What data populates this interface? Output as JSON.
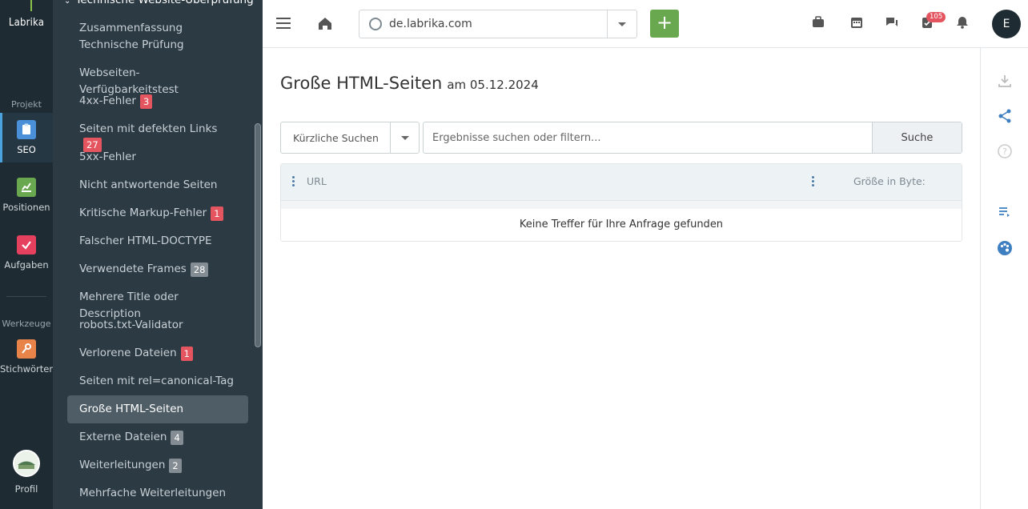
{
  "app": {
    "logo": "Labrika"
  },
  "rail": {
    "section_project": "Projekt",
    "section_tools": "Werkzeuge",
    "items": [
      {
        "label": "SEO",
        "icon": "clipboard-icon",
        "color": "#4a90d9",
        "active": true
      },
      {
        "label": "Positionen",
        "icon": "chart-icon",
        "color": "#6aa84f"
      },
      {
        "label": "Aufgaben",
        "icon": "check-icon",
        "color": "#e5405e"
      },
      {
        "label": "Stichwörter",
        "icon": "key-icon",
        "color": "#e8834a"
      }
    ],
    "profile_label": "Profil"
  },
  "menu": {
    "group_title": "Technische Website-Überprüfung",
    "items": [
      {
        "label": "Zusammenfassung Technische Prüfung"
      },
      {
        "label": "Webseiten-Verfügbarkeitstest"
      },
      {
        "label": "4xx-Fehler",
        "badge": "3"
      },
      {
        "label": "Seiten mit defekten Links",
        "badge": "27"
      },
      {
        "label": "5xx-Fehler"
      },
      {
        "label": "Nicht antwortende Seiten"
      },
      {
        "label": "Kritische Markup-Fehler",
        "badge": "1"
      },
      {
        "label": "Falscher HTML-DOCTYPE"
      },
      {
        "label": "Verwendete Frames",
        "badge": "28"
      },
      {
        "label": "Mehrere Title oder Description"
      },
      {
        "label": "robots.txt-Validator"
      },
      {
        "label": "Verlorene Dateien",
        "badge": "1"
      },
      {
        "label": "Seiten mit rel=canonical-Tag"
      },
      {
        "label": "Große HTML-Seiten",
        "selected": true
      },
      {
        "label": "Externe Dateien",
        "badge": "4"
      },
      {
        "label": "Weiterleitungen",
        "badge": "2"
      },
      {
        "label": "Mehrfache Weiterleitungen"
      }
    ]
  },
  "topbar": {
    "domain": "de.labrika.com",
    "add_label": "+",
    "tasks_badge": "105",
    "user_initial": "E"
  },
  "main": {
    "title": "Große HTML-Seiten",
    "date": "am 05.12.2024",
    "recent_search": "Kürzliche Suchen",
    "filter_placeholder": "Ergebnisse suchen oder filtern...",
    "search_button": "Suche",
    "columns": [
      "URL",
      "Größe in Byte:"
    ],
    "empty_message": "Keine Treffer für Ihre Anfrage gefunden"
  }
}
